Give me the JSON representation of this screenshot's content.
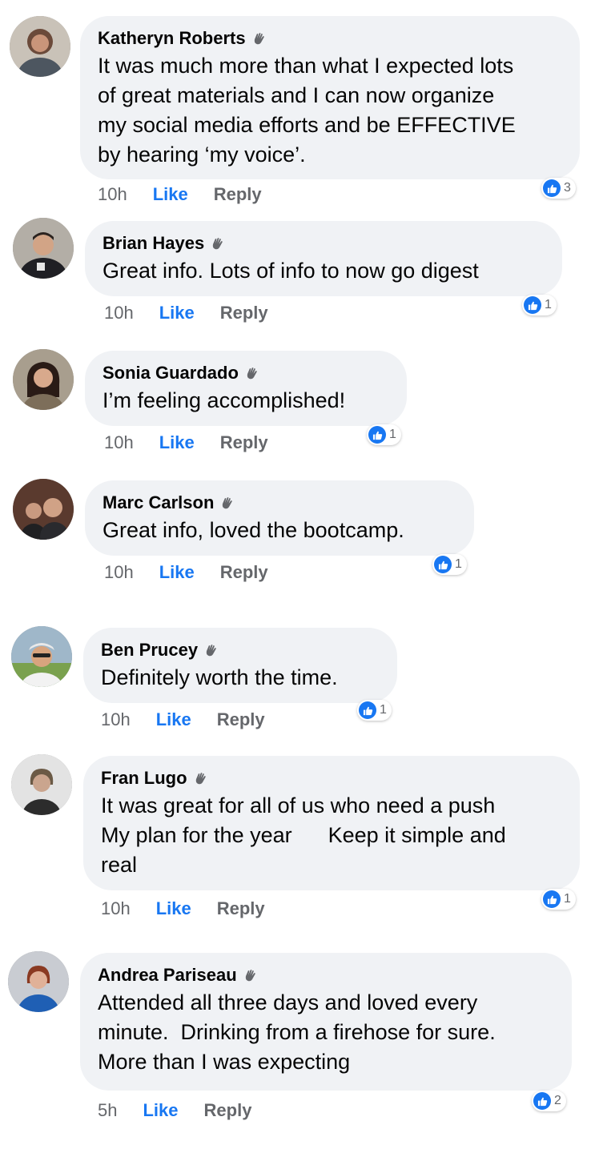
{
  "accent_color": "#1877f2",
  "bubble_color": "#f0f2f5",
  "comments": [
    {
      "author": "Katheryn Roberts",
      "text": "It was much more than what I expected lots\nof great materials and I can now organize\nmy social media efforts and be EFFECTIVE\nby hearing ‘my voice’.",
      "time": "10h",
      "like": "Like",
      "reply": "Reply",
      "reaction_count": "3"
    },
    {
      "author": "Brian Hayes",
      "text": "Great info. Lots of info to now go digest",
      "time": "10h",
      "like": "Like",
      "reply": "Reply",
      "reaction_count": "1"
    },
    {
      "author": "Sonia Guardado",
      "text": "I’m feeling accomplished!",
      "time": "10h",
      "like": "Like",
      "reply": "Reply",
      "reaction_count": "1"
    },
    {
      "author": "Marc Carlson",
      "text": "Great info, loved the bootcamp.",
      "time": "10h",
      "like": "Like",
      "reply": "Reply",
      "reaction_count": "1"
    },
    {
      "author": "Ben Prucey",
      "text": "Definitely worth the time.",
      "time": "10h",
      "like": "Like",
      "reply": "Reply",
      "reaction_count": "1"
    },
    {
      "author": "Fran Lugo",
      "text": "It was great for all of us who need a push\nMy plan for the year      Keep it simple and\nreal",
      "time": "10h",
      "like": "Like",
      "reply": "Reply",
      "reaction_count": "1"
    },
    {
      "author": "Andrea Pariseau",
      "text": "Attended all three days and loved every\nminute.  Drinking from a firehose for sure.\nMore than I was expecting",
      "time": "5h",
      "like": "Like",
      "reply": "Reply",
      "reaction_count": "2"
    }
  ]
}
